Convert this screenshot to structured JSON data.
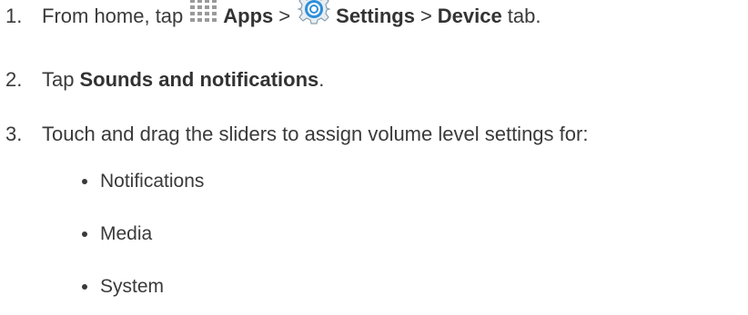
{
  "steps": [
    {
      "number": "1.",
      "text_before": "From home, tap",
      "apps_label": "Apps",
      "separator1": ">",
      "settings_label": "Settings",
      "separator2": ">",
      "device_label": "Device",
      "text_after": "tab."
    },
    {
      "number": "2.",
      "text_before": "Tap",
      "bold": "Sounds and notifications",
      "text_after": "."
    },
    {
      "number": "3.",
      "text": "Touch and drag the sliders to assign volume level settings for:"
    }
  ],
  "bullets": [
    "Notifications",
    "Media",
    "System"
  ],
  "icons": {
    "apps": "apps-grid-icon",
    "settings": "settings-gear-icon"
  },
  "colors": {
    "text": "#3a3a3a",
    "apps_icon": "#9a9a9a",
    "settings_icon": "#2f8fd8"
  }
}
